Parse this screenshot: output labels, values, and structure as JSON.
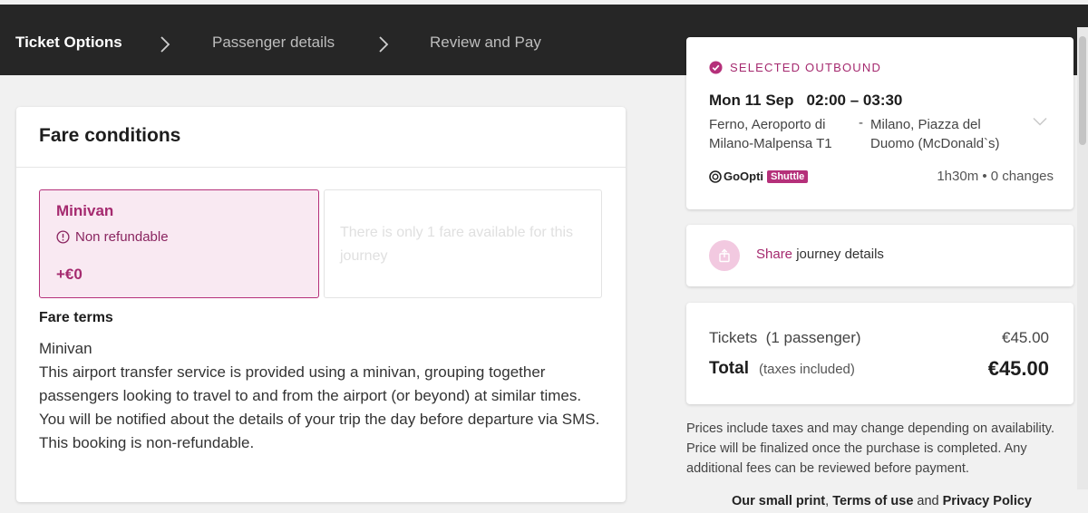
{
  "steps": [
    "Ticket Options",
    "Passenger details",
    "Review and Pay"
  ],
  "fare": {
    "title": "Fare conditions",
    "option": {
      "name": "Minivan",
      "refund": "Non refundable",
      "price": "+€0"
    },
    "empty_note": "There is only 1 fare available for this journey",
    "terms_title": "Fare terms",
    "terms_lines": [
      "Minivan",
      "This airport transfer service is provided using a minivan, grouping together passengers looking to travel to and from the airport (or beyond) at similar times.",
      "You will be notified about the details of your trip the day before departure via SMS.",
      "This booking is non-refundable."
    ]
  },
  "outbound": {
    "label": "SELECTED OUTBOUND",
    "date": "Mon 11 Sep",
    "time": "02:00 – 03:30",
    "from": "Ferno, Aeroporto di Milano-Malpensa T1",
    "dash": "-",
    "to": "Milano, Piazza del Duomo (McDonald`s)",
    "operator": "GoOpti",
    "badge": "Shuttle",
    "duration": "1h30m • 0 changes"
  },
  "share": {
    "link": "Share",
    "text": " journey details"
  },
  "price": {
    "tickets_label": "Tickets",
    "tickets_passengers": "(1 passenger)",
    "tickets_amount": "€45.00",
    "total_label": "Total",
    "total_tax": "(taxes included)",
    "total_amount": "€45.00"
  },
  "disclaimer": "Prices include taxes and may change depending on availability. Price will be finalized once the purchase is completed. Any additional fees can be reviewed before payment.",
  "footer": {
    "small_print": "Our small print",
    "comma": ", ",
    "terms": "Terms of use",
    "and": " and ",
    "privacy": "Privacy Policy"
  },
  "colors": {
    "accent": "#a52a6f",
    "topbar": "#262626",
    "selected_bg": "#f9e9f2"
  },
  "icons": [
    "chevron-right-icon",
    "info-circle-icon",
    "check-circle-icon",
    "chevron-down-icon",
    "share-icon",
    "goopti-logo-icon"
  ]
}
